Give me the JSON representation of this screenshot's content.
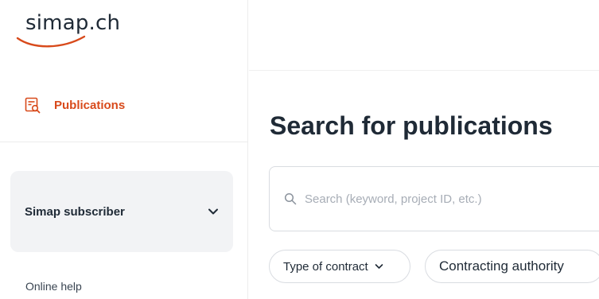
{
  "brand": {
    "logo_text": "simap.ch",
    "accent_color": "#d84a1b"
  },
  "sidebar": {
    "nav_items": [
      {
        "label": "Publications",
        "icon": "publications-search-icon",
        "active": true
      }
    ],
    "subscriber_panel": {
      "label": "Simap subscriber",
      "icon": "chevron-down-icon"
    },
    "online_help": "Online help"
  },
  "main": {
    "title": "Search for publications",
    "search": {
      "placeholder": "Search (keyword, project ID, etc.)",
      "value": "",
      "icon": "search-icon"
    },
    "filters": [
      {
        "label": "Type of contract",
        "icon": "chevron-down-icon"
      },
      {
        "label": "Contracting authority"
      }
    ]
  }
}
